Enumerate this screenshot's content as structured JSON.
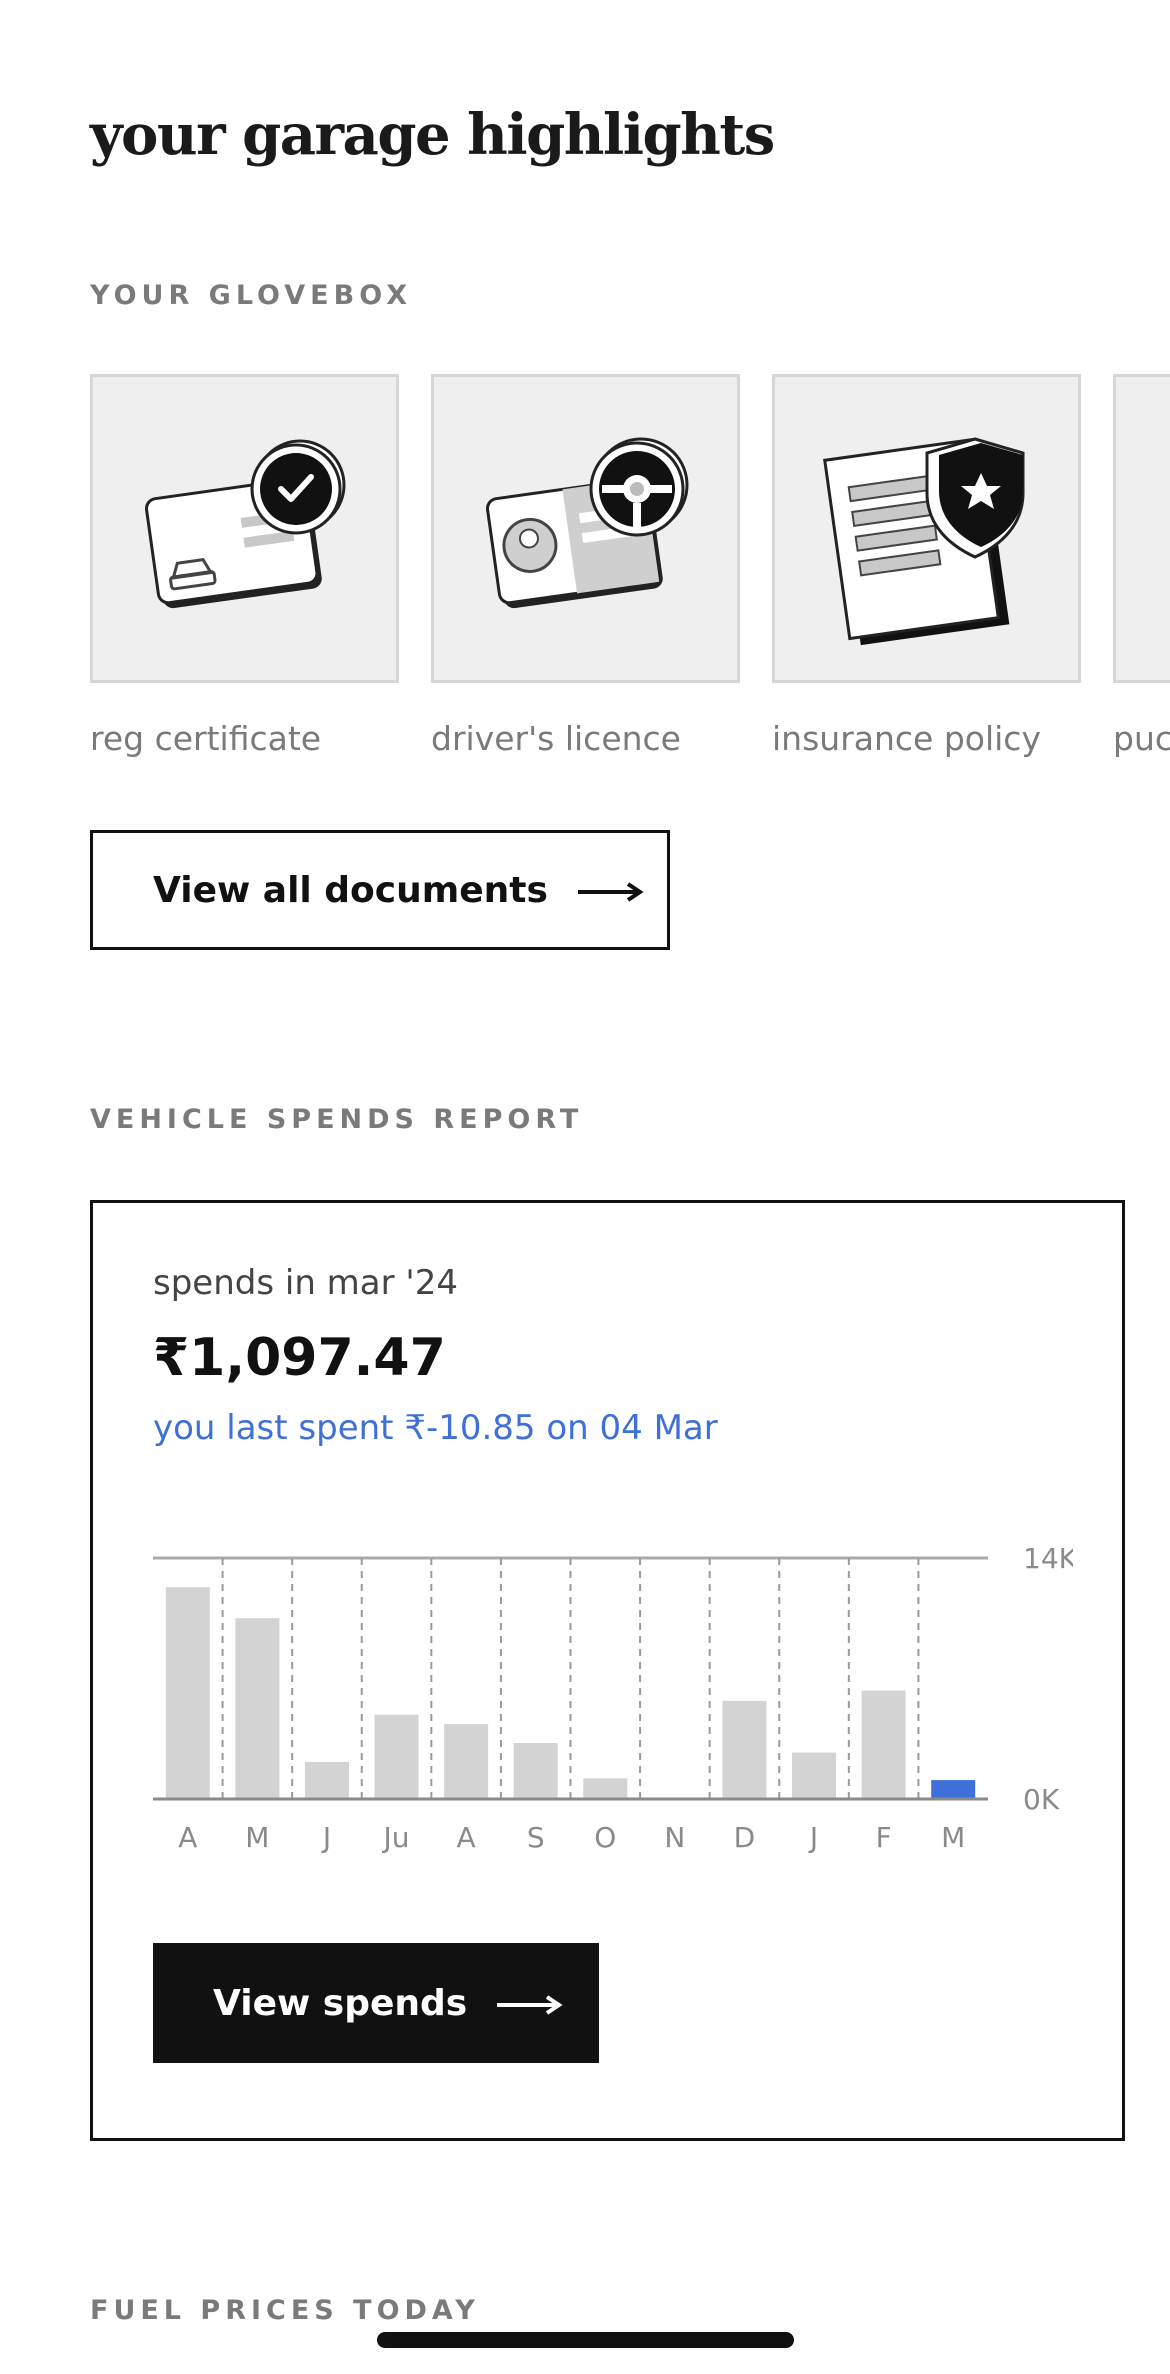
{
  "page": {
    "title": "your garage highlights"
  },
  "glovebox": {
    "section_label": "YOUR GLOVEBOX",
    "documents": [
      {
        "label": "reg certificate",
        "icon": "reg-certificate-icon"
      },
      {
        "label": "driver's licence",
        "icon": "drivers-licence-icon"
      },
      {
        "label": "insurance policy",
        "icon": "insurance-policy-icon"
      },
      {
        "label": "puc",
        "icon": "puc-certificate-icon"
      }
    ],
    "view_all_label": "View all documents"
  },
  "spends": {
    "section_label": "VEHICLE SPENDS REPORT",
    "subtitle": "spends in mar '24",
    "amount": "₹1,097.47",
    "last_spent": "you last spent ₹-10.85 on 04 Mar",
    "view_label": "View spends",
    "colors": {
      "bar": "#d3d3d3",
      "highlight": "#3f6fd8"
    }
  },
  "chart_data": {
    "type": "bar",
    "categories": [
      "A",
      "M",
      "J",
      "Ju",
      "A",
      "S",
      "O",
      "N",
      "D",
      "J",
      "F",
      "M"
    ],
    "values": [
      12300,
      10500,
      2150,
      4900,
      4350,
      3250,
      1200,
      0,
      5700,
      2700,
      6300,
      1097.47
    ],
    "highlight_index": 11,
    "ylim": [
      0,
      14000
    ],
    "yticks": [
      "14K",
      "0K"
    ],
    "grid": "dashed vertical separators"
  },
  "fuel": {
    "section_label": "FUEL PRICES TODAY"
  }
}
